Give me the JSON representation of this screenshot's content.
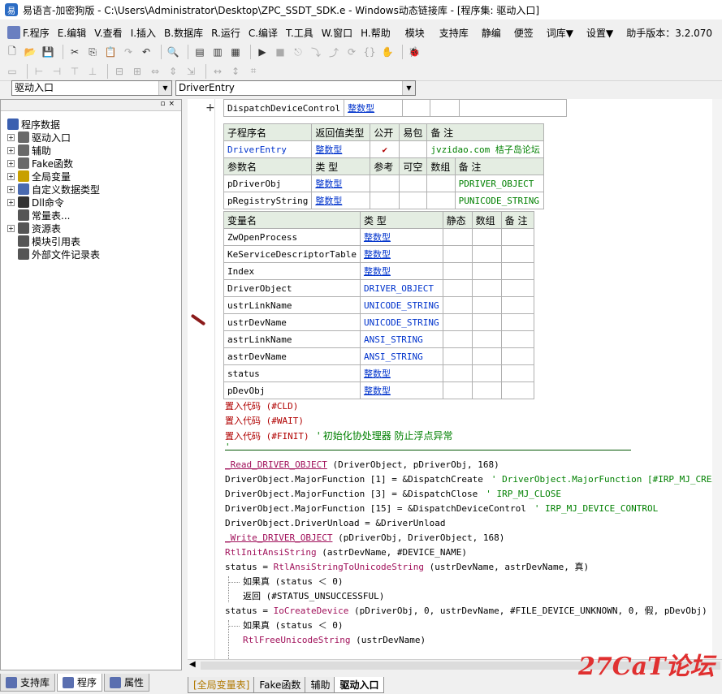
{
  "window": {
    "title": "易语言-加密狗版 - C:\\Users\\Administrator\\Desktop\\ZPC_SSDT_SDK.e - Windows动态链接库 - [程序集: 驱动入口]"
  },
  "menu": [
    "F.程序",
    "E.编辑",
    "V.查看",
    "I.插入",
    "B.数据库",
    "R.运行",
    "C.编译",
    "T.工具",
    "W.窗口",
    "H.帮助",
    "模块",
    "支持库",
    "静编",
    "便签",
    "词库▼",
    "设置▼",
    "助手版本：3.2.070"
  ],
  "combos": {
    "left": "驱动入口",
    "right": "DriverEntry"
  },
  "tree": {
    "root": "程序数据",
    "items": [
      {
        "label": "驱动入口",
        "expandable": true,
        "color": "#6a6a6a"
      },
      {
        "label": "辅助",
        "expandable": true,
        "color": "#6a6a6a"
      },
      {
        "label": "Fake函数",
        "expandable": true,
        "color": "#6a6a6a"
      },
      {
        "label": "全局变量",
        "expandable": true,
        "color": "#c8a000"
      },
      {
        "label": "自定义数据类型",
        "expandable": true,
        "color": "#4a6ab0"
      },
      {
        "label": "Dll命令",
        "expandable": true,
        "color": "#333333"
      },
      {
        "label": "常量表...",
        "expandable": false,
        "color": "#555555"
      },
      {
        "label": "资源表",
        "expandable": true,
        "color": "#555555"
      },
      {
        "label": "模块引用表",
        "expandable": false,
        "color": "#555555"
      },
      {
        "label": "外部文件记录表",
        "expandable": false,
        "color": "#555555"
      }
    ]
  },
  "left_tabs": [
    "支持库",
    "程序",
    "属性"
  ],
  "top_row": {
    "name": "DispatchDeviceControl",
    "type": "整数型"
  },
  "sub_table": {
    "headers": [
      "子程序名",
      "返回值类型",
      "公开",
      "易包",
      "备 注"
    ],
    "row": {
      "name": "DriverEntry",
      "ret": "整数型",
      "public": "✔",
      "note": "jvzidao.com 桔子岛论坛"
    },
    "param_headers": [
      "参数名",
      "类 型",
      "参考",
      "可空",
      "数组",
      "备 注"
    ],
    "params": [
      {
        "name": "pDriverObj",
        "type": "整数型",
        "note": "PDRIVER_OBJECT"
      },
      {
        "name": "pRegistryString",
        "type": "整数型",
        "note": "PUNICODE_STRING"
      }
    ]
  },
  "var_table": {
    "headers": [
      "变量名",
      "类 型",
      "静态",
      "数组",
      "备 注"
    ],
    "rows": [
      {
        "name": "ZwOpenProcess",
        "type": "整数型"
      },
      {
        "name": "KeServiceDescriptorTable",
        "type": "整数型"
      },
      {
        "name": "Index",
        "type": "整数型"
      },
      {
        "name": "DriverObject",
        "type": "DRIVER_OBJECT"
      },
      {
        "name": "ustrLinkName",
        "type": "UNICODE_STRING"
      },
      {
        "name": "ustrDevName",
        "type": "UNICODE_STRING"
      },
      {
        "name": "astrLinkName",
        "type": "ANSI_STRING"
      },
      {
        "name": "astrDevName",
        "type": "ANSI_STRING"
      },
      {
        "name": "status",
        "type": "整数型"
      },
      {
        "name": "pDevObj",
        "type": "整数型"
      }
    ]
  },
  "code": {
    "l1": "置入代码 (#CLD)",
    "l2": "置入代码 (#WAIT)",
    "l3": "置入代码 (#FINIT)",
    "l3c": "' 初始化协处理器 防止浮点异常",
    "l4": "'",
    "l5a": "_Read_DRIVER_OBJECT",
    "l5b": " (DriverObject, pDriverObj, 168)",
    "l6": "DriverObject.MajorFunction [1] = &DispatchCreate",
    "l6c": "' DriverObject.MajorFunction [#IRP_MJ_CREATE]",
    "l7": "DriverObject.MajorFunction [3] = &DispatchClose",
    "l7c": "' IRP_MJ_CLOSE",
    "l8": "DriverObject.MajorFunction [15] = &DispatchDeviceControl",
    "l8c": "' IRP_MJ_DEVICE_CONTROL",
    "l9": "DriverObject.DriverUnload = &DriverUnload",
    "l10a": "_Write_DRIVER_OBJECT",
    "l10b": " (pDriverObj, DriverObject, 168)",
    "l11a": "RtlInitAnsiString",
    "l11b": " (astrDevName, #DEVICE_NAME)",
    "l12a": "status = ",
    "l12b": "RtlAnsiStringToUnicodeString",
    "l12c": " (ustrDevName, astrDevName, 真)",
    "l13": "如果真 (status ＜ 0)",
    "l14": "返回 (#STATUS_UNSUCCESSFUL)",
    "l15a": "status = ",
    "l15b": "IoCreateDevice",
    "l15c": " (pDriverObj, 0, ustrDevName, #FILE_DEVICE_UNKNOWN, 0, 假, pDevObj)",
    "l16": "如果真 (status ＜ 0)",
    "l17a": "RtlFreeUnicodeString",
    "l17b": " (ustrDevName)"
  },
  "bottom_tabs": [
    "[全局变量表]",
    "Fake函数",
    "辅助",
    "驱动入口"
  ],
  "watermark": "27CaT论坛"
}
